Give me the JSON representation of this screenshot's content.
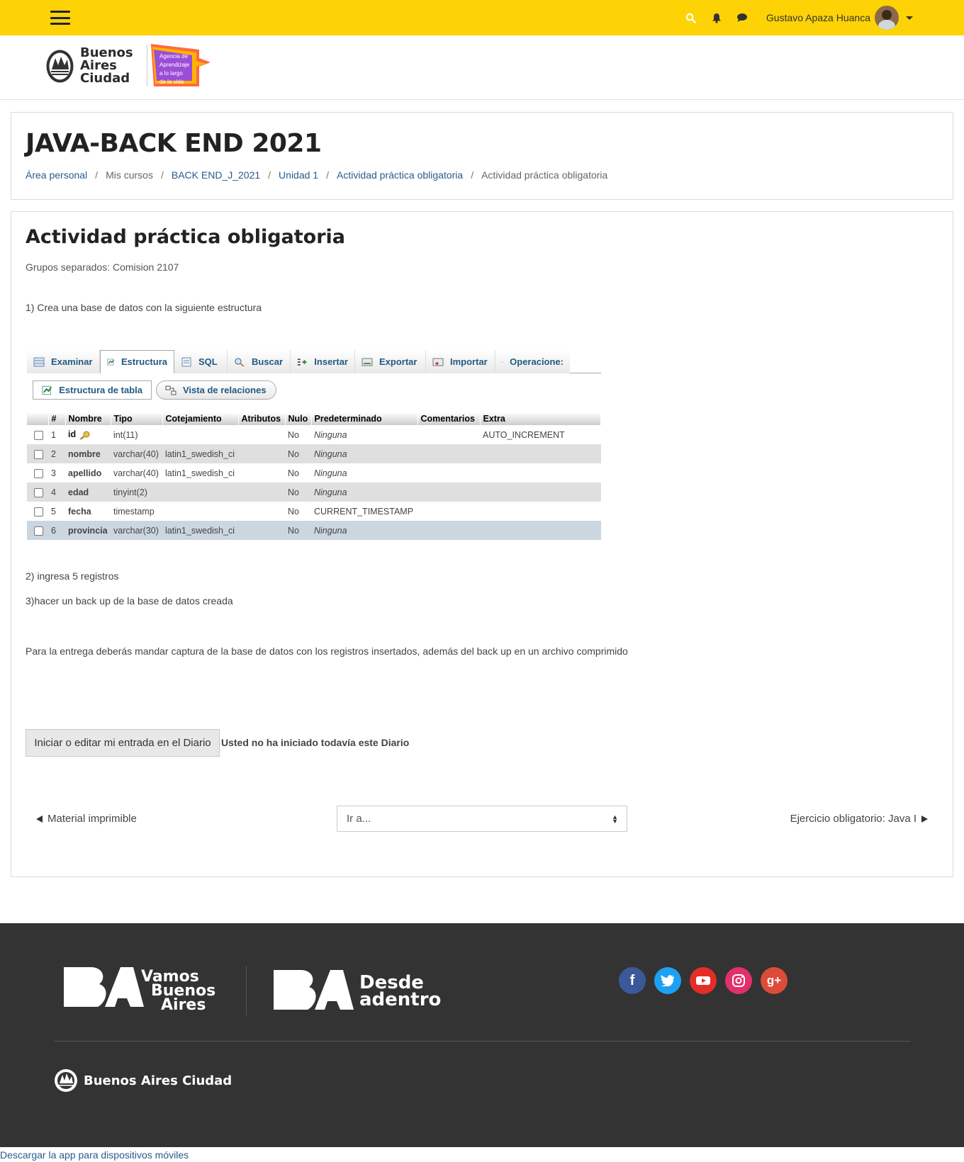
{
  "navbar": {
    "user_name": "Gustavo Apaza Huanca",
    "accent": "#fdd306"
  },
  "header_logos": {
    "ba_line1": "Buenos",
    "ba_line2": "Aires",
    "ba_line3": "Ciudad",
    "agencia_line1": "Agencia de",
    "agencia_line2": "Aprendizaje",
    "agencia_line3": "a lo largo",
    "agencia_line4": "de la vida"
  },
  "course": {
    "title": "JAVA-BACK END 2021",
    "breadcrumb": [
      "Área personal",
      "Mis cursos",
      "BACK END_J_2021",
      "Unidad 1",
      "Actividad práctica obligatoria",
      "Actividad práctica obligatoria"
    ]
  },
  "activity": {
    "title": "Actividad práctica obligatoria",
    "groups": "Grupos separados: Comision 2107",
    "p1": "1) Crea una base de datos con la siguiente estructura",
    "p2": "2) ingresa 5 registros",
    "p3": "3)hacer un back up de la base de datos creada",
    "p4": "Para la entrega deberás mandar captura de la base de datos con los registros insertados, además del back up en un archivo comprimido",
    "diary_button": "Iniciar o editar mi entrada en el Diario",
    "diary_status": "Usted no ha iniciado todavía este Diario",
    "prev_link": "Material imprimible",
    "next_link": "Ejercicio obligatorio: Java I",
    "jump_placeholder": "Ir a..."
  },
  "pma": {
    "tabs": [
      "Examinar",
      "Estructura",
      "SQL",
      "Buscar",
      "Insertar",
      "Exportar",
      "Importar",
      "Operacione:"
    ],
    "sub_tabs": [
      "Estructura de tabla",
      "Vista de relaciones"
    ],
    "columns": [
      "#",
      "Nombre",
      "Tipo",
      "Cotejamiento",
      "Atributos",
      "Nulo",
      "Predeterminado",
      "Comentarios",
      "Extra"
    ],
    "rows": [
      {
        "n": "1",
        "name": "id",
        "type": "int(11)",
        "coll": "",
        "attr": "",
        "null": "No",
        "def": "Ninguna",
        "comm": "",
        "extra": "AUTO_INCREMENT"
      },
      {
        "n": "2",
        "name": "nombre",
        "type": "varchar(40)",
        "coll": "latin1_swedish_ci",
        "attr": "",
        "null": "No",
        "def": "Ninguna",
        "comm": "",
        "extra": ""
      },
      {
        "n": "3",
        "name": "apellido",
        "type": "varchar(40)",
        "coll": "latin1_swedish_ci",
        "attr": "",
        "null": "No",
        "def": "Ninguna",
        "comm": "",
        "extra": ""
      },
      {
        "n": "4",
        "name": "edad",
        "type": "tinyint(2)",
        "coll": "",
        "attr": "",
        "null": "No",
        "def": "Ninguna",
        "comm": "",
        "extra": ""
      },
      {
        "n": "5",
        "name": "fecha",
        "type": "timestamp",
        "coll": "",
        "attr": "",
        "null": "No",
        "def": "CURRENT_TIMESTAMP",
        "comm": "",
        "extra": ""
      },
      {
        "n": "6",
        "name": "provincia",
        "type": "varchar(30)",
        "coll": "latin1_swedish_ci",
        "attr": "",
        "null": "No",
        "def": "Ninguna",
        "comm": "",
        "extra": ""
      }
    ]
  },
  "footer": {
    "vamos_l1": "Vamos",
    "vamos_l2": "Buenos",
    "vamos_l3": "Aires",
    "desde_l1": "Desde",
    "desde_l2": "adentro",
    "city_name": "Buenos Aires Ciudad",
    "socials": [
      {
        "name": "facebook",
        "color": "#3b5998",
        "glyph": "f"
      },
      {
        "name": "twitter",
        "color": "#1da1f2",
        "glyph": ""
      },
      {
        "name": "youtube",
        "color": "#e52d27",
        "glyph": ""
      },
      {
        "name": "instagram",
        "color": "#e1306c",
        "glyph": ""
      },
      {
        "name": "google-plus",
        "color": "#dd4b39",
        "glyph": "g+"
      }
    ]
  },
  "app_link": "Descargar la app para dispositivos móviles"
}
